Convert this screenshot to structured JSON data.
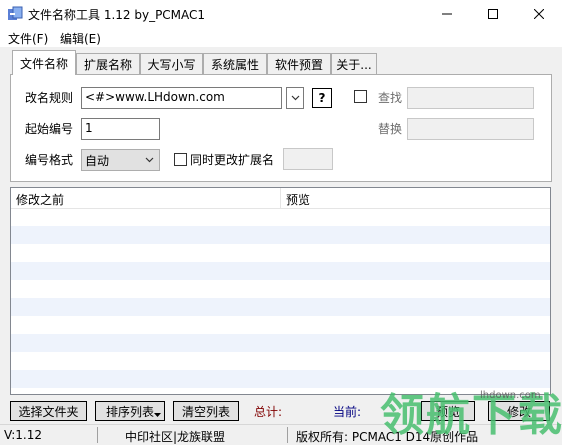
{
  "window": {
    "title": "文件名称工具 1.12  by_PCMAC1"
  },
  "menu": {
    "file": "文件(F)",
    "edit": "编辑(E)"
  },
  "tabs": [
    {
      "label": "文件名称",
      "active": true
    },
    {
      "label": "扩展名称",
      "active": false
    },
    {
      "label": "大写小写",
      "active": false
    },
    {
      "label": "系统属性",
      "active": false
    },
    {
      "label": "软件预置",
      "active": false
    },
    {
      "label": "关于...",
      "active": false
    }
  ],
  "rename_panel": {
    "rule_label": "改名规则",
    "rule_value": "<#>www.LHdown.com",
    "help_label": "?",
    "start_label": "起始编号",
    "start_value": "1",
    "format_label": "编号格式",
    "format_value": "自动",
    "sync_ext_label": "同时更改扩展名",
    "sync_ext_checked": false,
    "sync_ext_value": "",
    "find_checked": false,
    "find_label": "查找",
    "find_value": "",
    "replace_label": "替换",
    "replace_value": ""
  },
  "list": {
    "columns": [
      "修改之前",
      "预览"
    ],
    "rows": []
  },
  "actions": {
    "select_files": "选择文件夹",
    "sort_list": "排序列表",
    "clear_list": "清空列表",
    "total_label": "总计:",
    "current_label": "当前:",
    "preview": "预览",
    "modify": "修改"
  },
  "status": {
    "version": "V:1.12",
    "community": "中印社区|龙族联盟",
    "copyright": "版权所有: PCMAC1  D14原创作品"
  },
  "watermark": {
    "text": "领航下载",
    "url": "lhdown.com",
    "color": "#48be6e"
  }
}
